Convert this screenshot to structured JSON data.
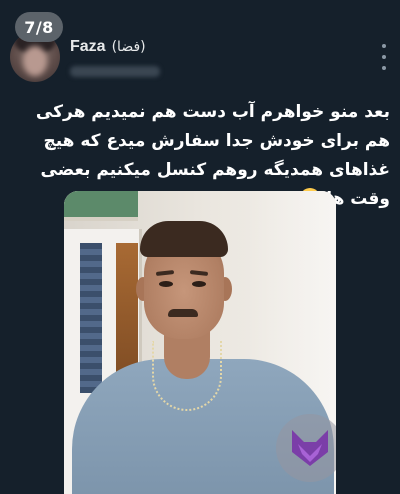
{
  "thread": {
    "counter": "7/8"
  },
  "author": {
    "name": "Faza",
    "name_fa": "(فضا)"
  },
  "tweet": {
    "text": "بعد منو خواهرم آب دست هم نمیدیم هرکی هم برای خودش جدا سفارش میدع که هیچ غذاهای همدیگه روهم کنسل میکنیم بعضی وقت ها",
    "emoji": "neutral-face-icon"
  },
  "media": {
    "watermark_icon": "fox-logo-icon"
  },
  "colors": {
    "background": "#15202b",
    "text": "#e7e9ea",
    "counter_bg": "#5c636a",
    "watermark": "#7b3ea8"
  }
}
